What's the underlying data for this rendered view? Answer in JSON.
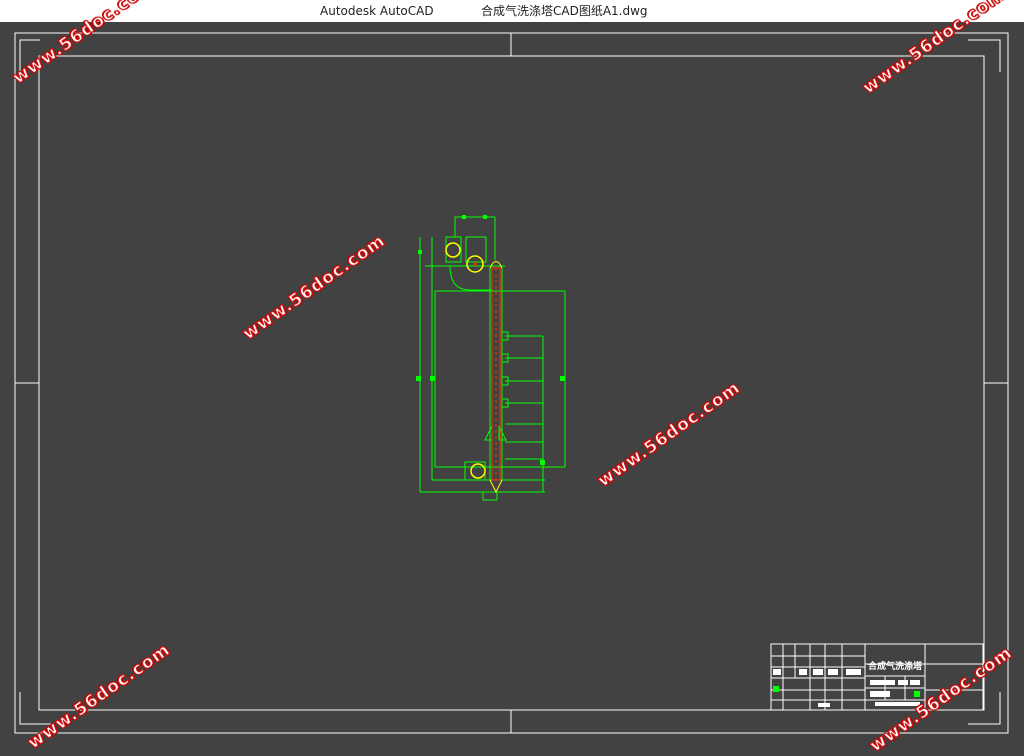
{
  "window": {
    "app_name": "Autodesk AutoCAD",
    "file_name": "合成气洗涤塔CAD图纸A1.dwg"
  },
  "title_block": {
    "drawing_title": "合成气洗涤塔"
  },
  "watermarks": {
    "text": "www.56doc.com",
    "color": "#d01a1a"
  },
  "colors": {
    "background": "#424242",
    "frame": "#ffffff",
    "drawing_lines": "#00ff00",
    "vessel_outline": "#ffff00",
    "hatching": "#ff3300"
  }
}
